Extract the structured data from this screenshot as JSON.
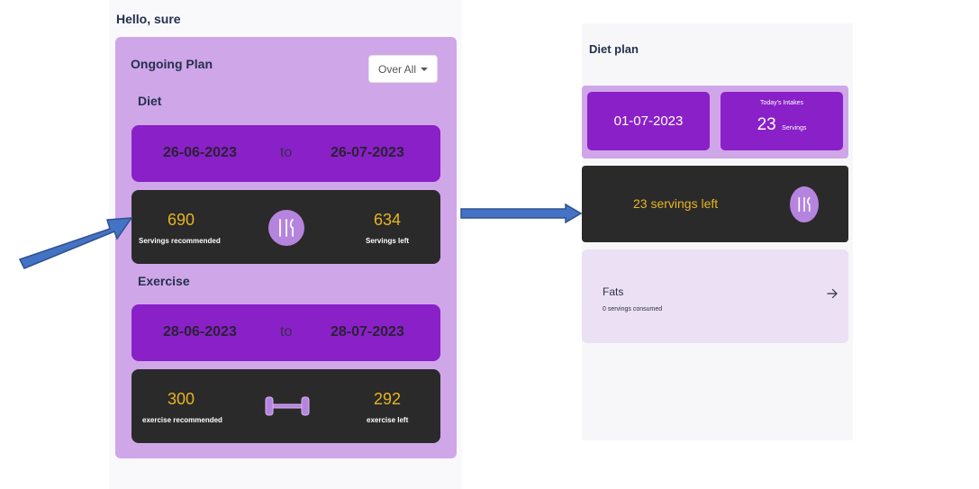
{
  "left_screen": {
    "greeting": "Hello, sure",
    "plan_title": "Ongoing Plan",
    "filter": {
      "selected": "Over All"
    },
    "diet": {
      "label": "Diet",
      "start_date": "26-06-2023",
      "separator": "to",
      "end_date": "26-07-2023",
      "recommended_value": "690",
      "recommended_caption": "Servings recommended",
      "left_value": "634",
      "left_caption": "Servings left",
      "icon": "cutlery-icon"
    },
    "exercise": {
      "label": "Exercise",
      "start_date": "28-06-2023",
      "separator": "to",
      "end_date": "28-07-2023",
      "recommended_value": "300",
      "recommended_caption": "exercise recommended",
      "left_value": "292",
      "left_caption": "exercise left",
      "icon": "dumbbell-icon"
    }
  },
  "right_screen": {
    "title": "Diet plan",
    "date": "01-07-2023",
    "intakes_title": "Today's Intakes",
    "intakes_value": "23",
    "intakes_unit": "Servings",
    "servings_left_text": "23 servings left",
    "fats": {
      "title": "Fats",
      "subtitle": "0 servings consumed"
    }
  },
  "colors": {
    "panel_lavender": "#cfa6e8",
    "accent_purple": "#8a20c8",
    "dark_card": "#2a2a2a",
    "number_gold": "#e8b422",
    "arrow_blue": "#3a6fc4"
  }
}
